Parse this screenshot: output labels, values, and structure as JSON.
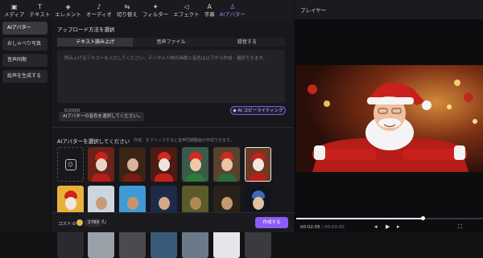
{
  "toolbar": {
    "items": [
      {
        "label": "メディア",
        "icon": "media-icon"
      },
      {
        "label": "テキスト",
        "icon": "text-icon"
      },
      {
        "label": "エレメント",
        "icon": "element-icon"
      },
      {
        "label": "オーディオ",
        "icon": "audio-icon"
      },
      {
        "label": "切り替え",
        "icon": "transition-icon"
      },
      {
        "label": "フィルター",
        "icon": "filter-icon"
      },
      {
        "label": "エフェクト",
        "icon": "effect-icon"
      },
      {
        "label": "字幕",
        "icon": "subtitle-icon"
      },
      {
        "label": "AIアバター",
        "icon": "ai-avatar-icon"
      }
    ],
    "active_index": 8
  },
  "player": {
    "title": "プレイヤー",
    "current_time": "00:02:05",
    "separator": " / ",
    "total_time": "00:03:00",
    "progress": 0.68
  },
  "sidebar": {
    "items": [
      "AIアバター",
      "おしゃべり写真",
      "音声同期",
      "絵声を生成する"
    ],
    "active_index": 0
  },
  "main": {
    "upload_title": "アップロード方法を選択",
    "tabs": [
      "テキスト読み上げ",
      "音声ファイル",
      "録音する"
    ],
    "active_tab": 0,
    "text_placeholder": "読み上げるテキストを入力してください。デジタル人物の画像と音色は以下から作成・選択できます。",
    "char_count": "0/2000",
    "ai_copy_button": "AI コピーライティング",
    "voice_select": "AIアバターの音色を選択してください",
    "avatar_title": "AIアバターを選択してください",
    "avatar_hint": "作成：をクリックすると音声同期動画が作成できます。"
  },
  "bottom": {
    "cost_label": "コスト:0",
    "cost_value": "2789",
    "generate_button": "作成する"
  },
  "colors": {
    "accent": "#8b5cf6",
    "background": "#18181c"
  }
}
